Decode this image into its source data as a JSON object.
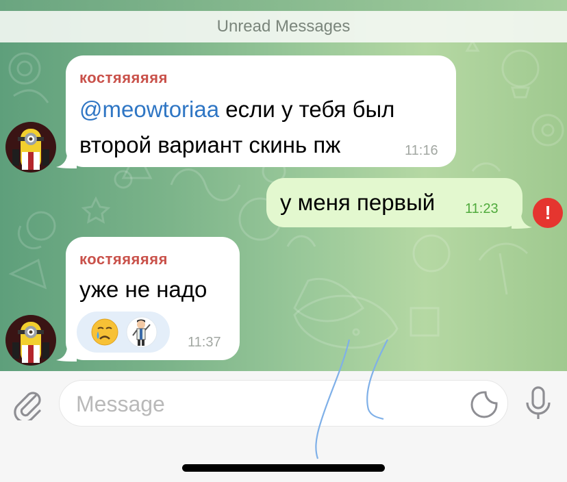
{
  "unread_banner": "Unread Messages",
  "messages": [
    {
      "sender": "костяяяяяя",
      "mention": "@meowtoriaa",
      "line1_rest": " если у тебя был",
      "line2": "второй вариант скинь пж",
      "time": "11:16"
    },
    {
      "text": "у меня первый",
      "time": "11:23",
      "status": "!"
    },
    {
      "sender": "костяяяяяя",
      "text": "уже не надо",
      "time": "11:37",
      "reactions": [
        "crying-face",
        "waving-man-sticker"
      ]
    }
  ],
  "composer": {
    "placeholder": "Message"
  },
  "colors": {
    "sender_name": "#c9514a",
    "mention": "#2f76c4",
    "outgoing_bubble": "#e3f8cf",
    "outgoing_time": "#4faa3c",
    "error": "#e5352f"
  }
}
